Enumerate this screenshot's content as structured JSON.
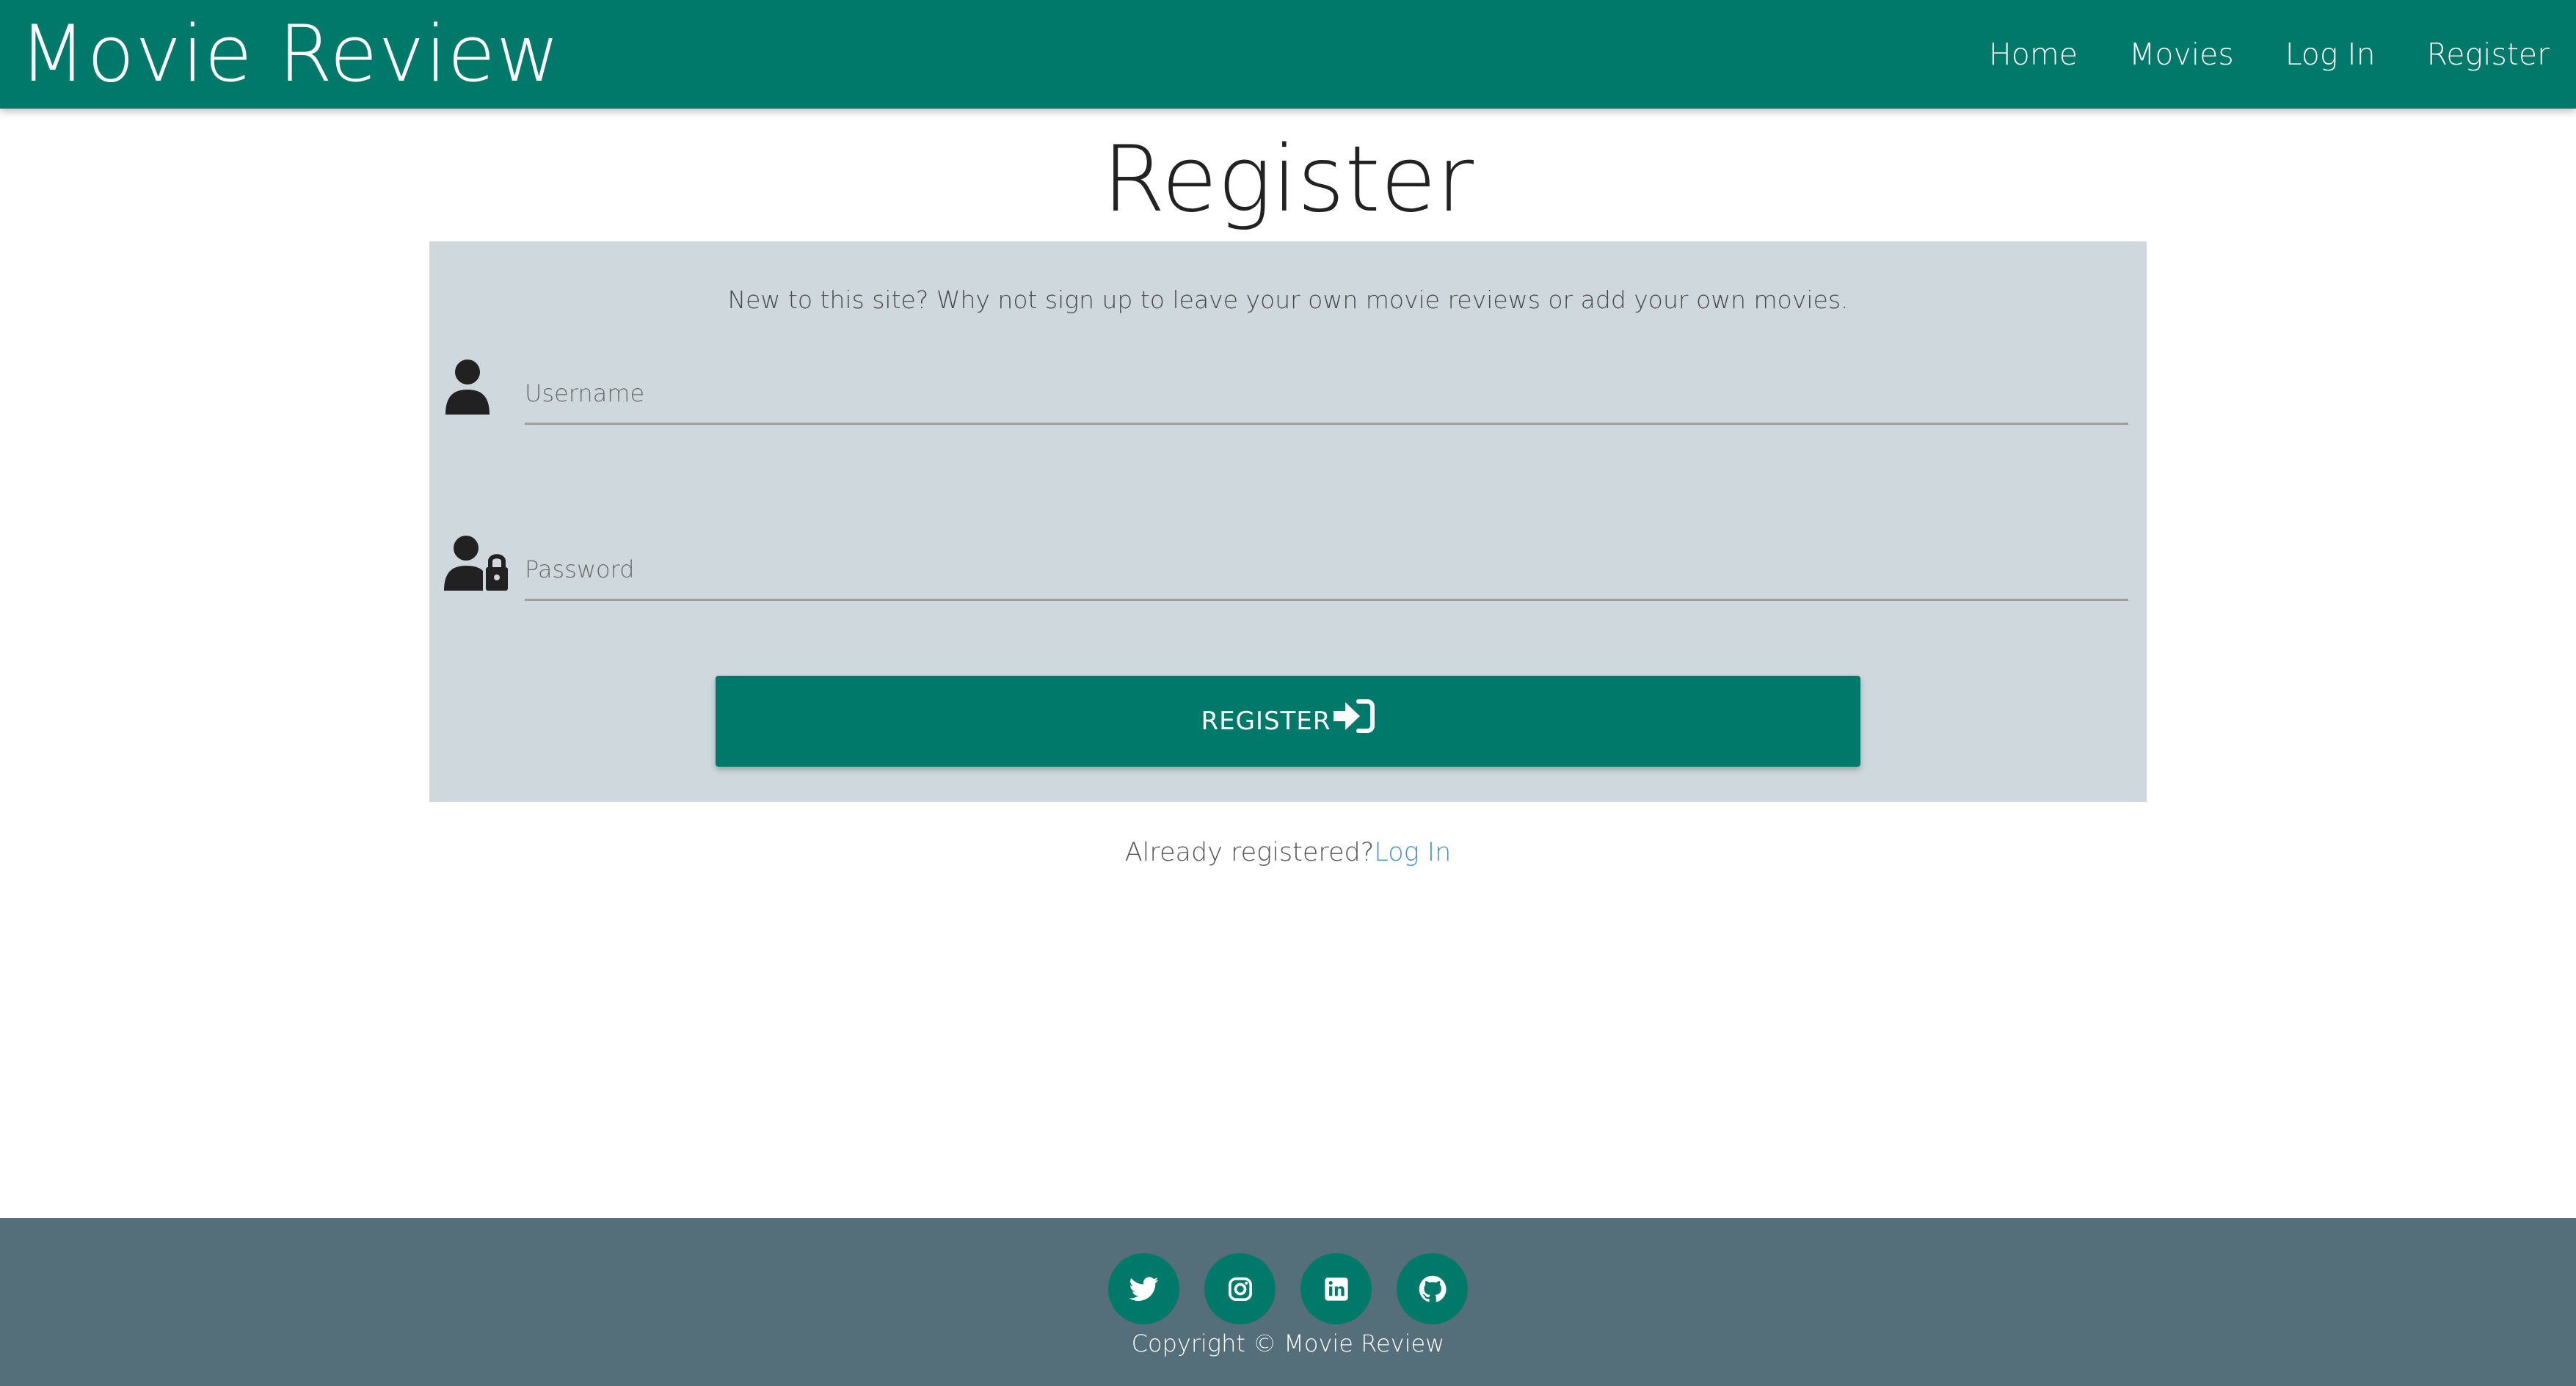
{
  "navbar": {
    "brand": "Movie Review",
    "links": [
      "Home",
      "Movies",
      "Log In",
      "Register"
    ]
  },
  "page": {
    "title": "Register"
  },
  "form": {
    "intro": "New to this site? Why not sign up to leave your own movie reviews or add your own movies.",
    "username_placeholder": "Username",
    "password_placeholder": "Password",
    "submit_label": "REGISTER"
  },
  "login_prompt": {
    "text": "Already registered?",
    "link": "Log In"
  },
  "footer": {
    "icons": [
      "twitter-icon",
      "instagram-icon",
      "linkedin-icon",
      "github-icon"
    ],
    "copyright": "Copyright © Movie Review"
  },
  "colors": {
    "primary": "#00796b",
    "card": "#cfd8dc",
    "footer": "#546e7a",
    "link": "#4a90c8"
  }
}
